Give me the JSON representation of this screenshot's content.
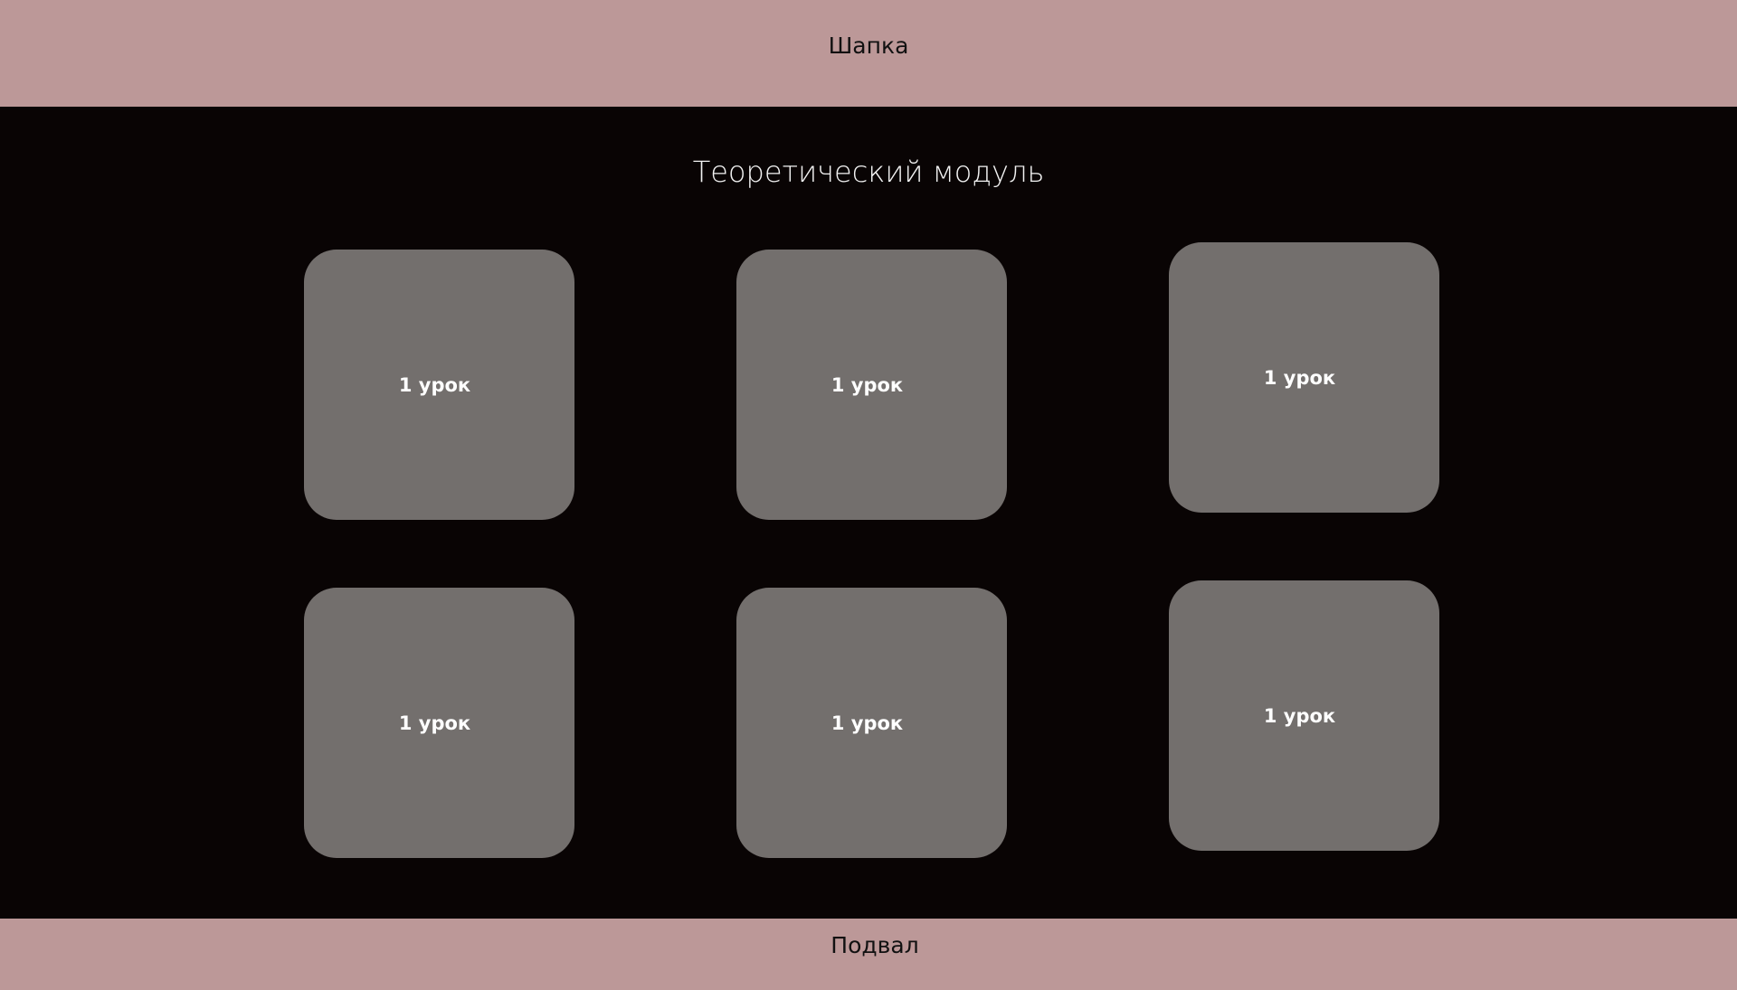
{
  "header": {
    "label": "Шапка"
  },
  "module": {
    "title": "Теоретический модуль",
    "lessons": [
      {
        "label": "1 урок"
      },
      {
        "label": "1 урок"
      },
      {
        "label": "1 урок"
      },
      {
        "label": "1 урок"
      },
      {
        "label": "1 урок"
      },
      {
        "label": "1 урок"
      }
    ]
  },
  "footer": {
    "label": "Подвал"
  },
  "colors": {
    "header_bg": "#bc9898",
    "main_bg": "#090404",
    "card_bg": "#736f6d",
    "card_text": "#ffffff",
    "title_text": "#f2f2f2"
  }
}
